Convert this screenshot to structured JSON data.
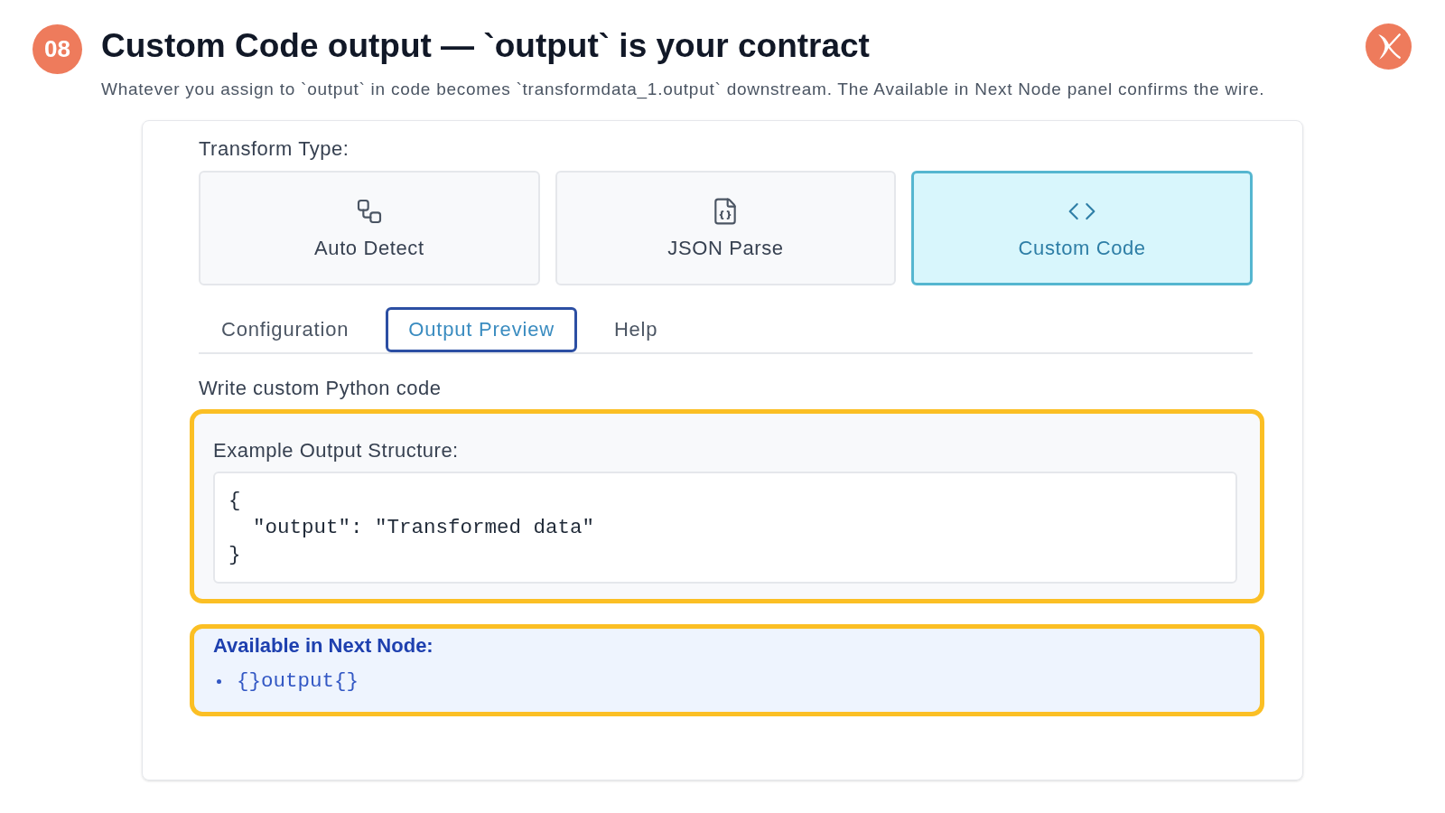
{
  "header": {
    "step_badge": "08",
    "title": "Custom Code output — `output` is your contract",
    "subtitle": "Whatever you assign to `output` in code becomes `transformdata_1.output` downstream. The Available in Next Node panel confirms the wire."
  },
  "panel": {
    "transform_type": {
      "label": "Transform Type:",
      "options": [
        {
          "label": "Auto Detect",
          "kind": "detect",
          "selected": false
        },
        {
          "label": "JSON Parse",
          "kind": "json",
          "selected": false
        },
        {
          "label": "Custom Code",
          "kind": "code",
          "selected": true
        }
      ]
    },
    "tabs": [
      {
        "label": "Configuration",
        "selected": false
      },
      {
        "label": "Output Preview",
        "selected": true
      },
      {
        "label": "Help",
        "selected": false
      }
    ],
    "section_label": "Write custom Python code",
    "example_output": {
      "label": "Example Output Structure:",
      "highlighted": true,
      "code_lines": [
        "{",
        "  \"output\": \"Transformed data\"",
        "}"
      ]
    },
    "next_node": {
      "label": "Available in Next Node:",
      "highlighted": true,
      "items": [
        "{}output{}"
      ]
    }
  }
}
